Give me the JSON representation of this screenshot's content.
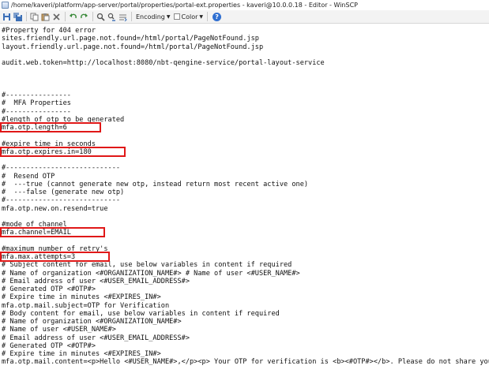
{
  "window": {
    "title": "/home/kaveri/platform/app-server/portal/properties/portal-ext.properties - kaveri@10.0.0.18 - Editor - WinSCP"
  },
  "toolbar": {
    "buttons": [
      {
        "name": "save-icon"
      },
      {
        "name": "save-all-icon"
      },
      {
        "name": "copy-icon"
      },
      {
        "name": "paste-icon"
      },
      {
        "name": "delete-icon"
      },
      {
        "name": "undo-icon"
      },
      {
        "name": "redo-icon"
      },
      {
        "name": "find-icon"
      },
      {
        "name": "replace-icon"
      },
      {
        "name": "goto-line-icon"
      }
    ],
    "encoding_label": "Encoding",
    "color_label": "Color",
    "help_label": "?"
  },
  "editor": {
    "lines": [
      "#Property for 404 error",
      "sites.friendly.url.page.not.found=/html/portal/PageNotFound.jsp",
      "layout.friendly.url.page.not.found=/html/portal/PageNotFound.jsp",
      "",
      "audit.web.token=http://localhost:8080/nbt-qengine-service/portal-layout-service",
      "",
      "",
      "",
      "#----------------",
      "#  MFA Properties",
      "#----------------",
      "#length of otp to be generated",
      "mfa.otp.length=6",
      "",
      "#expire time in seconds",
      "mfa.otp.expires.in=180",
      "",
      "#----------------------------",
      "#  Resend OTP",
      "#  ---true (cannot generate new otp, instead return most recent active one)",
      "#  ---false (generate new otp)",
      "#----------------------------",
      "mfa.otp.new.on.resend=true",
      "",
      "#mode of channel",
      "mfa.channel=EMAIL",
      "",
      "#maximum number of retry's",
      "mfa.max.attempts=3",
      "# Subject content for email, use below variables in content if required",
      "# Name of organization <#ORGANIZATION_NAME#> # Name of user <#USER_NAME#>",
      "# Email address of user <#USER_EMAIL_ADDRESS#>",
      "# Generated OTP <#OTP#>",
      "# Expire time in minutes <#EXPIRES_IN#>",
      "mfa.otp.mail.subject=OTP for Verification",
      "# Body content for email, use below variables in content if required",
      "# Name of organization <#ORGANIZATION_NAME#>",
      "# Name of user <#USER_NAME#>",
      "# Email address of user <#USER_EMAIL_ADDRESS#>",
      "# Generated OTP <#OTP#>",
      "# Expire time in minutes <#EXPIRES_IN#>",
      "mfa.otp.mail.content=<p>Hello <#USER_NAME#>,</p><p> Your OTP for verification is <b><#OTP#></b>. Please do not share your OTP with"
    ],
    "highlighted_lines": [
      12,
      15,
      25,
      28
    ],
    "highlight_color": "#e01818"
  }
}
